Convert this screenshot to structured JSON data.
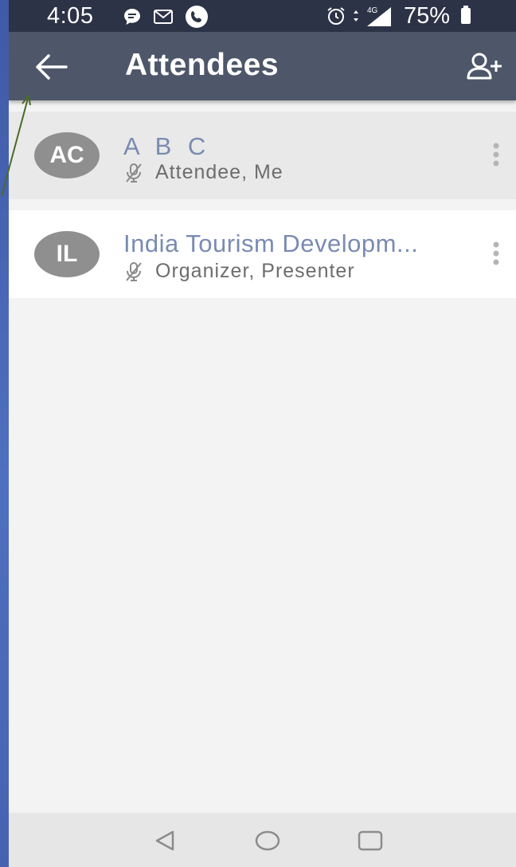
{
  "status_bar": {
    "time": "4:05",
    "signal_label": "4G",
    "battery": "75%"
  },
  "app_bar": {
    "title": "Attendees"
  },
  "attendees": [
    {
      "initials": "AC",
      "name": "A B C",
      "role": "Attendee, Me"
    },
    {
      "initials": "IL",
      "name": "India Tourism Developm...",
      "role": "Organizer, Presenter"
    }
  ],
  "colors": {
    "slide_background": "#4a67b3",
    "app_bar": "#4e5769",
    "status_bar": "#2c3347",
    "name_text": "#7a8bb1",
    "avatar": "#8f8f8f"
  },
  "icons": {
    "back": "arrow-left-icon",
    "add_attendee": "add-person-icon",
    "muted_mic": "mic-off-icon",
    "more": "more-vertical-icon"
  }
}
